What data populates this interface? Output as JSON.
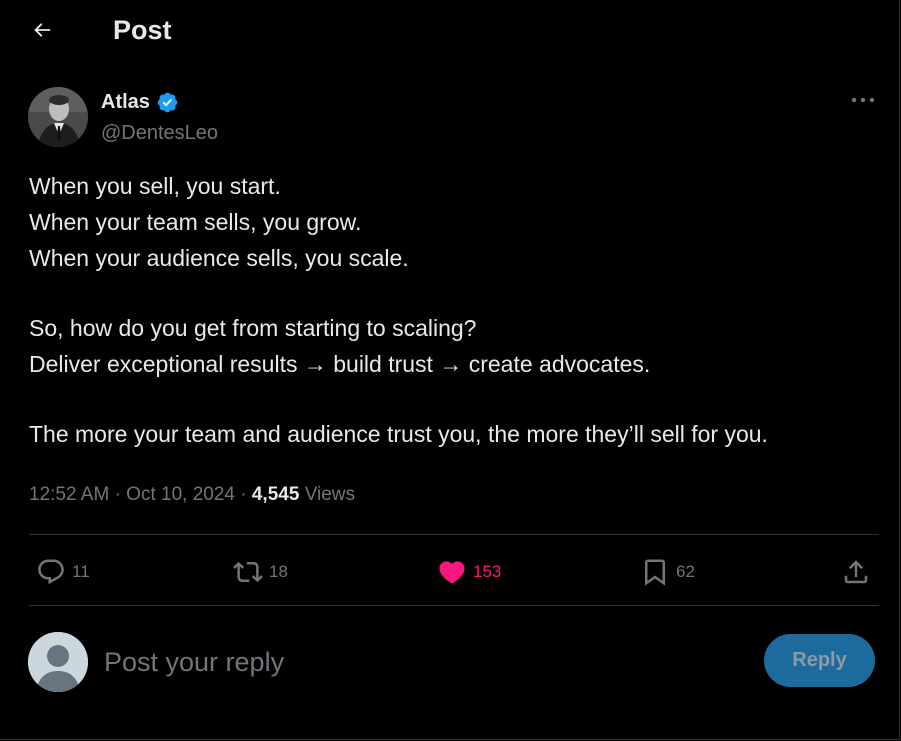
{
  "header": {
    "title": "Post",
    "back_icon": "arrow-left-icon"
  },
  "author": {
    "name": "Atlas",
    "handle": "@DentesLeo",
    "verified": true,
    "verified_color": "#1d9bf0"
  },
  "post": {
    "paragraphs": [
      [
        "When you sell, you start.",
        "When your team sells, you grow.",
        "When your audience sells, you scale."
      ],
      [
        "So, how do you get from starting to scaling?",
        "Deliver exceptional results → build trust → create advocates."
      ],
      [
        "The more your team and audience trust you, the more they’ll sell for you."
      ]
    ]
  },
  "meta": {
    "time": "12:52 AM",
    "separator": "·",
    "date": "Oct 10, 2024",
    "views_count": "4,545",
    "views_label": "Views"
  },
  "actions": {
    "replies": "11",
    "reposts": "18",
    "likes": "153",
    "bookmarks": "62",
    "liked": true,
    "like_color": "#f91880"
  },
  "reply_box": {
    "placeholder": "Post your reply",
    "button_label": "Reply"
  },
  "colors": {
    "background": "#000000",
    "text": "#e7e9ea",
    "secondary": "#71767b",
    "divider": "#2f3336",
    "reply_button": "#1d6a9c"
  }
}
